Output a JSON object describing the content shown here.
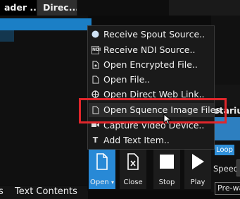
{
  "tabs": [
    {
      "label": "ader ..."
    },
    {
      "label": "Direc..."
    },
    {
      "label": ""
    }
  ],
  "bottom_tabs": [
    {
      "label": "s"
    },
    {
      "label": "Text Contents"
    }
  ],
  "right_panel": {
    "title_fragment": "etarium",
    "loop_label": "Loop",
    "speed_label": "Speed",
    "prewarm_label": "Pre-wa"
  },
  "menu": {
    "items": [
      {
        "label": "Receive Spout Source..",
        "icon": "spout-circle-icon"
      },
      {
        "label": "Receive NDI Source..",
        "icon": "ndi-icon"
      },
      {
        "label": "Open Encrypted File..",
        "icon": "encrypted-file-icon"
      },
      {
        "label": "Open File..",
        "icon": "file-icon"
      },
      {
        "label": "Open Direct Web Link..",
        "icon": "web-link-icon"
      },
      {
        "label": "Open Squence Image Files..",
        "icon": "image-sequence-icon"
      },
      {
        "label": "Capture Video Device..",
        "icon": "video-capture-icon"
      },
      {
        "label": "Add Text Item..",
        "icon": "text-icon"
      }
    ],
    "highlighted_index": 5
  },
  "toolbar": {
    "open_label": "Open",
    "close_label": "Close",
    "stop_label": "Stop",
    "play_label": "Play"
  },
  "colors": {
    "accent": "#2889d6",
    "highlight_border": "#e0262b"
  }
}
